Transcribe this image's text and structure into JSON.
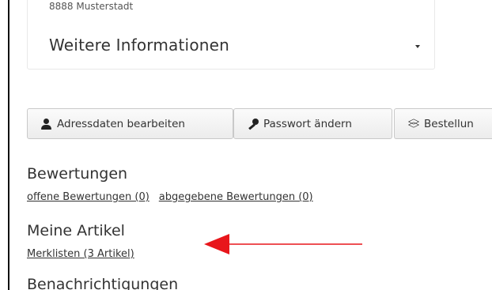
{
  "address": {
    "city_line": "8888 Musterstadt"
  },
  "details": {
    "label": "Weitere Informationen"
  },
  "buttons": {
    "address": "Adressdaten bearbeiten",
    "password": "Passwort ändern",
    "orders": "Bestellun"
  },
  "ratings": {
    "title": "Bewertungen",
    "open": "offene Bewertungen (0)",
    "submitted": "abgegebene Bewertungen (0)"
  },
  "articles": {
    "title": "Meine Artikel",
    "wishlists": "Merklisten (3 Artikel)"
  },
  "notifications": {
    "title": "Benachrichtigungen"
  },
  "annotation": {
    "arrow_color": "#e8161b"
  }
}
